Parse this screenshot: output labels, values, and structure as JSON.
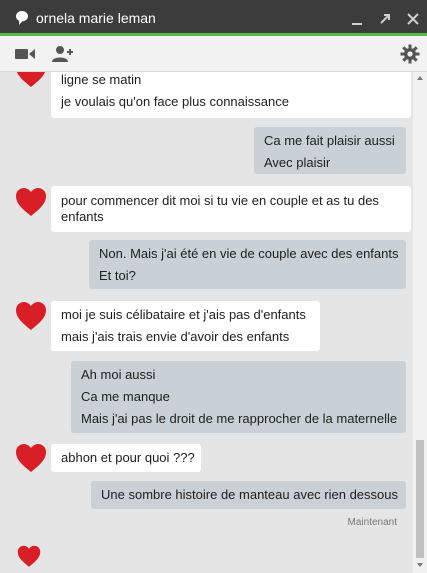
{
  "window": {
    "title": "ornela marie leman",
    "controls": [
      "minimize-icon",
      "popout-icon",
      "close-icon"
    ]
  },
  "toolbar": {
    "icons": [
      "video-call-icon",
      "add-person-icon",
      "settings-gear-icon"
    ]
  },
  "messages": [
    {
      "from": "contact",
      "lines": [
        "ligne se matin",
        "je voulais qu'on face plus connaissance"
      ]
    },
    {
      "from": "me",
      "lines": [
        "Ca me fait plaisir aussi",
        "Avec plaisir"
      ]
    },
    {
      "from": "contact",
      "lines": [
        "pour commencer dit moi si  tu vie en couple et as tu des enfants"
      ]
    },
    {
      "from": "me",
      "lines": [
        "Non. Mais j'ai été en vie de couple avec des enfants",
        "Et toi?"
      ]
    },
    {
      "from": "contact",
      "lines": [
        "moi je suis célibataire et j'ais pas d'enfants",
        "mais j'ais trais envie d'avoir des enfants"
      ]
    },
    {
      "from": "me",
      "lines": [
        "Ah moi aussi",
        "Ca me manque",
        "Mais j'ai pas le droit de me rapprocher de la maternelle"
      ]
    },
    {
      "from": "contact",
      "lines": [
        "abhon et pour quoi ???"
      ]
    },
    {
      "from": "me",
      "lines": [
        "Une sombre histoire de manteau avec rien dessous"
      ]
    }
  ],
  "timestamp": "Maintenant",
  "colors": {
    "titlebar": "#3c3c3c",
    "accent": "#58b848",
    "thread_bg": "#e5e5e5",
    "incoming_bubble": "#ffffff",
    "outgoing_bubble": "#c9d1d6",
    "avatar_heart": "#d81f26"
  }
}
